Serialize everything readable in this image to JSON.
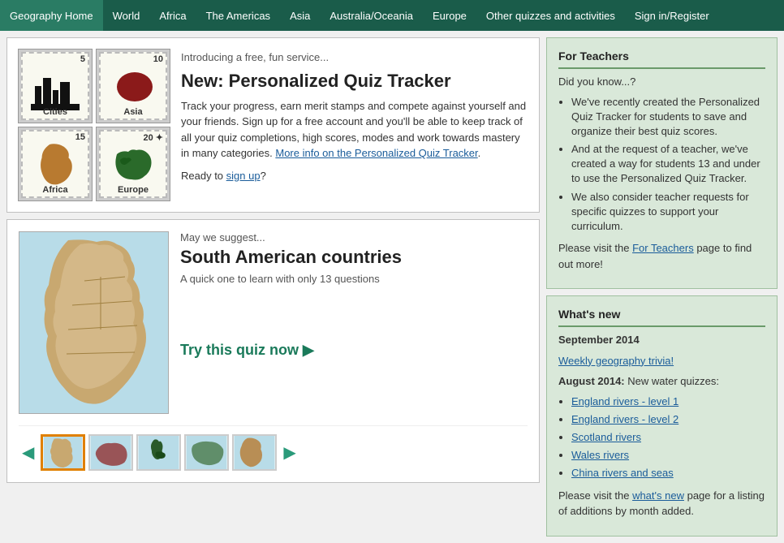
{
  "nav": {
    "items": [
      {
        "label": "Geography Home",
        "href": "#"
      },
      {
        "label": "World",
        "href": "#"
      },
      {
        "label": "Africa",
        "href": "#"
      },
      {
        "label": "The Americas",
        "href": "#"
      },
      {
        "label": "Asia",
        "href": "#"
      },
      {
        "label": "Australia/Oceania",
        "href": "#"
      },
      {
        "label": "Europe",
        "href": "#"
      },
      {
        "label": "Other quizzes and activities",
        "href": "#"
      },
      {
        "label": "Sign in/Register",
        "href": "#"
      }
    ]
  },
  "intro": {
    "heading": "Introducing a free, fun service...",
    "title": "New: Personalized Quiz Tracker",
    "body": "Track your progress, earn merit stamps and compete against yourself and your friends. Sign up for a free account and you'll be able to keep track of all your quiz completions, high scores, modes and work towards mastery in many categories.",
    "link_text": "More info on the Personalized Quiz Tracker",
    "ready_text": "Ready to",
    "signup_text": "sign up",
    "ready_end": "?"
  },
  "stamps": [
    {
      "label": "Cities",
      "number": "5",
      "type": "cities"
    },
    {
      "label": "Asia",
      "number": "10",
      "type": "asia"
    },
    {
      "label": "Africa",
      "number": "15",
      "type": "africa"
    },
    {
      "label": "Europe",
      "number": "20",
      "type": "europe"
    }
  ],
  "suggest": {
    "heading": "May we suggest...",
    "title": "South American countries",
    "subtitle": "A quick one to learn with only 13 questions",
    "cta": "Try this quiz now"
  },
  "for_teachers": {
    "title": "For Teachers",
    "intro": "Did you know...?",
    "bullets": [
      "We've recently created the Personalized Quiz Tracker for students to save and organize their best quiz scores.",
      "And at the request of a teacher, we've created a way for students 13 and under to use the Personalized Quiz Tracker.",
      "We also consider teacher requests for specific quizzes to support your curriculum."
    ],
    "footer": "Please visit the",
    "footer_link": "For Teachers",
    "footer_end": "page to find out more!"
  },
  "whats_new": {
    "title": "What's new",
    "sep_date": "September 2014",
    "sep_link": "Weekly geography trivia!",
    "aug_intro": "August 2014:",
    "aug_text": " New water quizzes:",
    "aug_links": [
      "England rivers - level 1",
      "England rivers - level 2",
      "Scotland rivers",
      "Wales rivers",
      "China rivers and seas"
    ],
    "footer": "Please visit the",
    "footer_link": "what's new",
    "footer_end": "page for a listing of additions by month added."
  }
}
